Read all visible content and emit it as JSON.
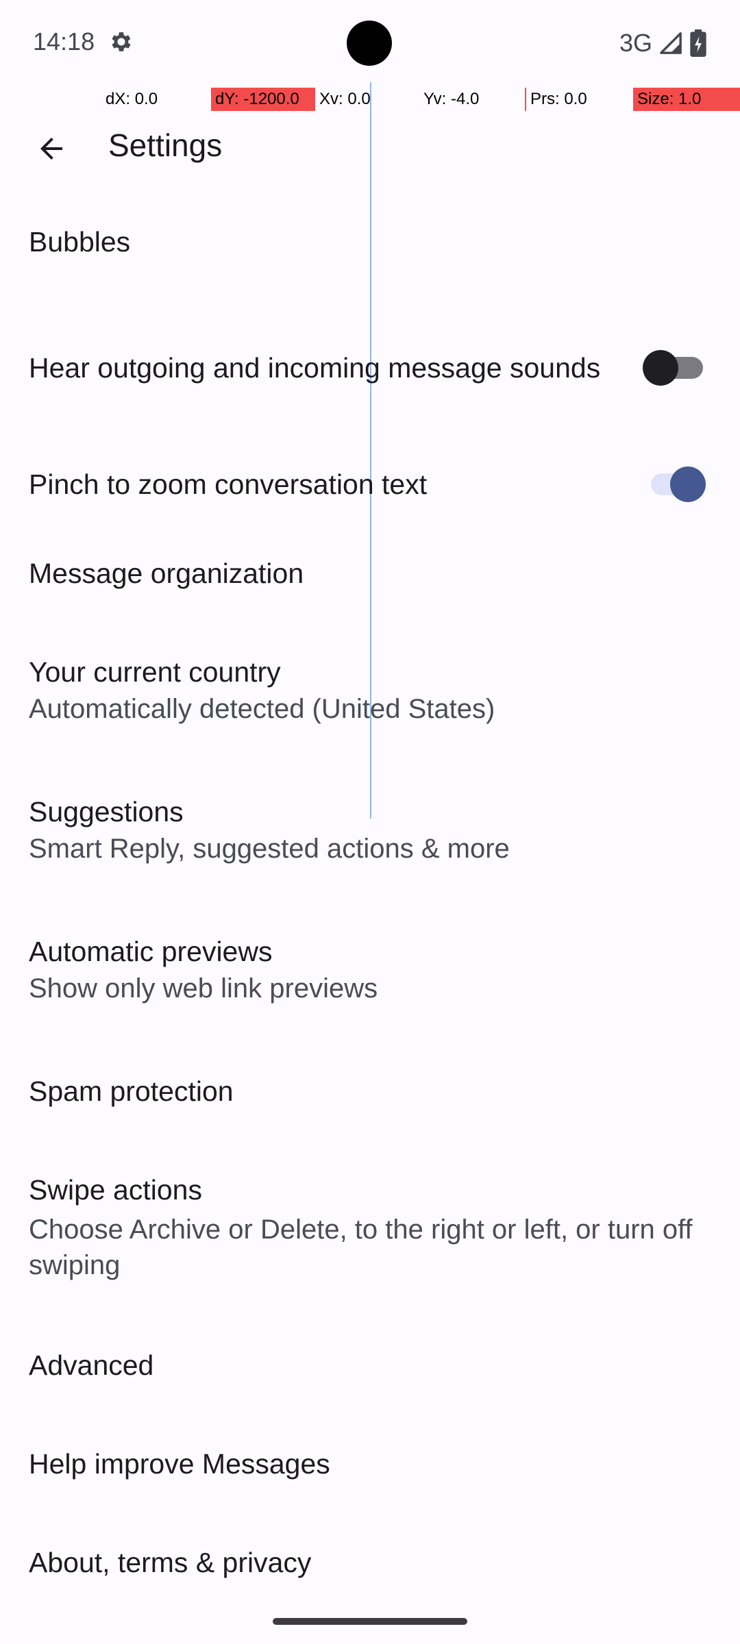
{
  "status_bar": {
    "time": "14:18",
    "network": "3G",
    "icons": [
      "settings-gear-icon",
      "signal-icon",
      "battery-icon"
    ]
  },
  "pointer_overlay": {
    "dx": "dX: 0.0",
    "dy": "dY: -1200.0",
    "xv": "Xv: 0.0",
    "yv": "Yv: -4.0",
    "prs": "Prs: 0.0",
    "size": "Size: 1.0",
    "highlight_color": "#f44c4c"
  },
  "app_bar": {
    "title": "Settings",
    "back_icon": "arrow-back-icon"
  },
  "settings": {
    "bubbles": {
      "title": "Bubbles"
    },
    "sounds": {
      "title": "Hear outgoing and incoming message sounds",
      "enabled": false
    },
    "pinch_zoom": {
      "title": "Pinch to zoom conversation text",
      "enabled": true
    },
    "message_organization": {
      "title": "Message organization"
    },
    "country": {
      "title": "Your current country",
      "subtitle": "Automatically detected (United States)"
    },
    "suggestions": {
      "title": "Suggestions",
      "subtitle": "Smart Reply, suggested actions & more"
    },
    "previews": {
      "title": "Automatic previews",
      "subtitle": "Show only web link previews"
    },
    "spam": {
      "title": "Spam protection"
    },
    "swipe": {
      "title": "Swipe actions",
      "subtitle": "Choose Archive or Delete, to the right or left, or turn off swiping"
    },
    "advanced": {
      "title": "Advanced"
    },
    "help": {
      "title": "Help improve Messages"
    },
    "about": {
      "title": "About, terms & privacy"
    }
  },
  "colors": {
    "background": "#fdfbff",
    "switch_on_thumb": "#465891",
    "switch_on_track": "#dfe2f8",
    "switch_off_thumb": "#1f1f23",
    "switch_off_track": "#7a7b80"
  }
}
